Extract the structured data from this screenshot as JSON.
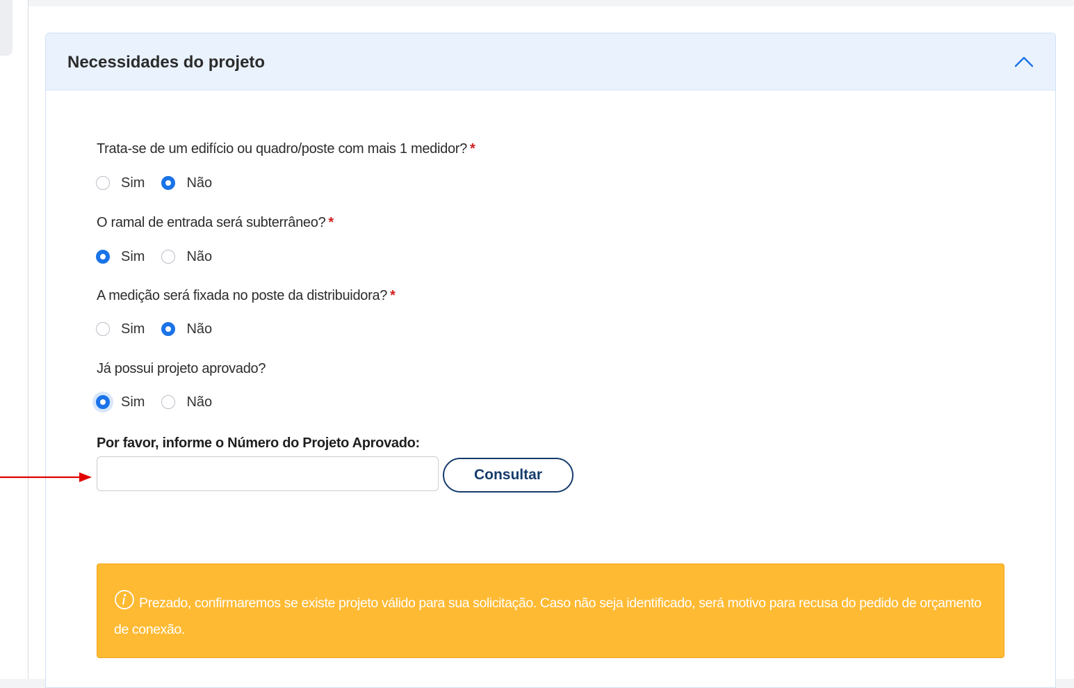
{
  "section": {
    "title": "Necessidades do projeto"
  },
  "questions": [
    {
      "text": "Trata-se de um edifício ou quadro/poste com mais 1 medidor?",
      "required_mark": "*",
      "options": [
        "Sim",
        "Não"
      ],
      "selected": "Não"
    },
    {
      "text": "O ramal de entrada será subterrâneo?",
      "required_mark": "*",
      "options": [
        "Sim",
        "Não"
      ],
      "selected": "Sim"
    },
    {
      "text": "A medição será fixada no poste da distribuidora?",
      "required_mark": "*",
      "options": [
        "Sim",
        "Não"
      ],
      "selected": "Não"
    },
    {
      "text": "Já possui projeto aprovado?",
      "required_mark": "",
      "options": [
        "Sim",
        "Não"
      ],
      "selected": "Sim"
    }
  ],
  "project_number": {
    "label": "Por favor, informe o Número do Projeto Aprovado:",
    "value": "",
    "placeholder": "",
    "button_label": "Consultar"
  },
  "alert": {
    "text": "Prezado, confirmaremos se existe projeto válido para sua solicitação. Caso não seja identificado, será motivo para recusa do pedido de orçamento de conexão.",
    "color": "#ffba33"
  },
  "colors": {
    "accent": "#1a73e8",
    "header_bg": "#e9f2fd",
    "required": "#d21f1f",
    "button_border": "#153b6b",
    "annotation_arrow": "#e00000"
  },
  "icons": {
    "collapse": "chevron-up-icon",
    "info": "info-circle-icon",
    "annotation": "red-arrow-pointer"
  }
}
